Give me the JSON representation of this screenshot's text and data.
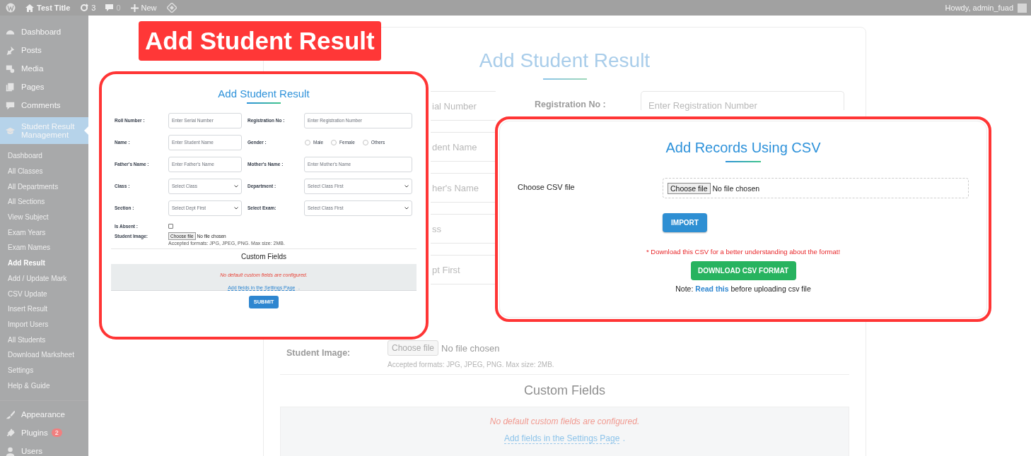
{
  "admin_bar": {
    "site_title": "Test Title",
    "updates": "3",
    "comments": "0",
    "new_label": "New",
    "greeting": "Howdy, admin_fuad"
  },
  "sidebar": {
    "items": [
      {
        "kind": "dashboard",
        "label": "Dashboard",
        "selected": false
      },
      {
        "kind": "posts",
        "label": "Posts",
        "selected": false
      },
      {
        "kind": "media",
        "label": "Media",
        "selected": false
      },
      {
        "kind": "pages",
        "label": "Pages",
        "selected": false
      },
      {
        "kind": "comments",
        "label": "Comments",
        "selected": false
      },
      {
        "kind": "students",
        "label": "Student Result Management",
        "selected": true,
        "children": [
          {
            "label": "Dashboard",
            "selected": false
          },
          {
            "label": "All Classes",
            "selected": false
          },
          {
            "label": "All Departments",
            "selected": false
          },
          {
            "label": "All Sections",
            "selected": false
          },
          {
            "label": "View Subject",
            "selected": false
          },
          {
            "label": "Exam Years",
            "selected": false
          },
          {
            "label": "Exam Names",
            "selected": false
          },
          {
            "label": "Add Result",
            "selected": true
          },
          {
            "label": "Add / Update Mark",
            "selected": false
          },
          {
            "label": "CSV Update",
            "selected": false
          },
          {
            "label": "Insert Result",
            "selected": false
          },
          {
            "label": "Import Users",
            "selected": false
          },
          {
            "label": "All Students",
            "selected": false
          },
          {
            "label": "Download Marksheet",
            "selected": false
          },
          {
            "label": "Settings",
            "selected": false
          },
          {
            "label": "Help & Guide",
            "selected": false
          }
        ]
      },
      {
        "kind": "appearance",
        "label": "Appearance",
        "selected": false
      },
      {
        "kind": "plugins",
        "label": "Plugins",
        "selected": false,
        "badge": "2"
      },
      {
        "kind": "users",
        "label": "Users",
        "selected": false
      }
    ]
  },
  "background_form": {
    "title": "Add Student Result",
    "rows": [
      {
        "left_placeholder": "ial Number",
        "right_label": "Registration No :",
        "right_placeholder": "Enter Registration Number"
      },
      {
        "left_placeholder": "dent Name"
      },
      {
        "left_placeholder": "her's Name"
      },
      {
        "left_placeholder": "ss"
      },
      {
        "left_placeholder": "pt First"
      }
    ],
    "image_label": "Student Image:",
    "file_button": "Choose file",
    "file_status": "No file chosen",
    "file_hint": "Accepted formats: JPG, JPEG, PNG. Max size: 2MB.",
    "custom_title": "Custom Fields",
    "custom_empty": "No default custom fields are configured.",
    "custom_link": "Add fields in the Settings Page",
    "custom_link_suffix": "."
  },
  "banner": {
    "title": "Add Student Result"
  },
  "form_preview": {
    "title": "Add Student Result",
    "rows": [
      [
        {
          "label": "Roll Number :",
          "kind": "text",
          "placeholder": "Enter Serial Number"
        },
        {
          "label": "Registration No :",
          "kind": "text",
          "placeholder": "Enter Registration Number"
        }
      ],
      [
        {
          "label": "Name :",
          "kind": "text",
          "placeholder": "Enter Student Name"
        },
        {
          "label": "Gender :",
          "kind": "radio",
          "options": [
            {
              "label": "Male",
              "selected": false
            },
            {
              "label": "Female",
              "selected": false
            },
            {
              "label": "Others",
              "selected": false
            }
          ]
        }
      ],
      [
        {
          "label": "Father's Name :",
          "kind": "text",
          "placeholder": "Enter Father's Name"
        },
        {
          "label": "Mother's Name :",
          "kind": "text",
          "placeholder": "Enter Mother's Name"
        }
      ],
      [
        {
          "label": "Class :",
          "kind": "select",
          "value": "Select Class"
        },
        {
          "label": "Department :",
          "kind": "select",
          "value": "Select Class First"
        }
      ],
      [
        {
          "label": "Section :",
          "kind": "select",
          "value": "Select Dept First"
        },
        {
          "label": "Select Exam:",
          "kind": "select",
          "value": "Select Class First"
        }
      ]
    ],
    "absent_label": "Is Absent :",
    "absent_checked": false,
    "image_label": "Student Image:",
    "file_button": "Choose file",
    "file_status": "No file chosen",
    "file_hint": "Accepted formats: JPG, JPEG, PNG. Max size: 2MB.",
    "custom_title": "Custom Fields",
    "custom_empty": "No default custom fields are configured.",
    "custom_link": "Add fields in the Settings Page",
    "custom_link_suffix": ".",
    "submit": "SUBMIT"
  },
  "csv_card": {
    "title": "Add Records Using CSV",
    "file_label": "Choose CSV file",
    "file_button": "Choose file",
    "file_status": "No file chosen",
    "import": "IMPORT",
    "download_note": "* Download this CSV for a better understanding about the format!",
    "download": "DOWNLOAD CSV FORMAT",
    "footer_prefix": "Note:",
    "footer_link": "Read this",
    "footer_suffix": "before uploading csv file"
  }
}
